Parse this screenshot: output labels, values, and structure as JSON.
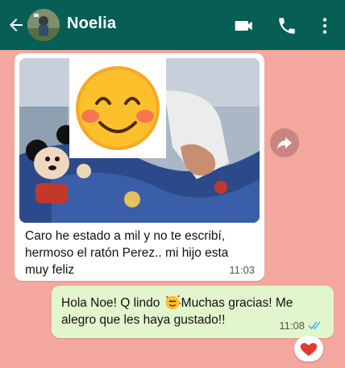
{
  "header": {
    "contact_name": "Noelia",
    "icons": [
      "back-arrow-icon",
      "avatar",
      "video-call-icon",
      "phone-icon",
      "more-vert-icon"
    ]
  },
  "colors": {
    "header_bg": "#075e54",
    "chat_bg": "#f4a79f",
    "incoming_bubble": "#ffffff",
    "outgoing_bubble": "#e1f6cc",
    "read_ticks": "#4fb3f7"
  },
  "messages": [
    {
      "direction": "incoming",
      "has_photo": true,
      "lines": [
        "Caro he estado a mil y no te escribí,",
        "hermoso el ratón Perez.. mi hijo esta",
        "muy feliz"
      ],
      "time": "11:03"
    },
    {
      "direction": "outgoing",
      "line1_before_emoji": "Hola Noe! Q lindo ",
      "line1_after_emoji": "Muchas gracias! Me",
      "line2": "alegro que les haya gustado!!",
      "time": "11:08",
      "status": "read",
      "reaction": "heart"
    }
  ]
}
